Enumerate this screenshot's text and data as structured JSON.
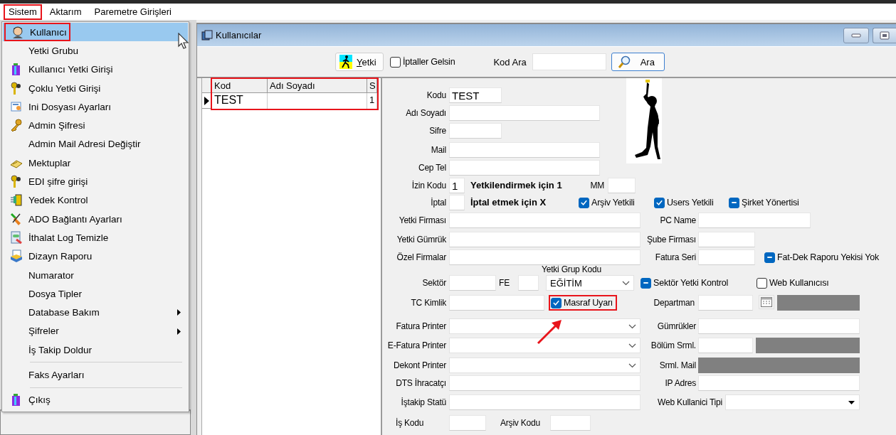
{
  "menubar": [
    {
      "label": "Sistem",
      "outlined": true
    },
    {
      "label": "Aktarım",
      "outlined": false
    },
    {
      "label": "Paremetre Girişleri",
      "outlined": false
    }
  ],
  "menu": {
    "items": [
      {
        "kind": "item",
        "label": "Kullanıcı",
        "selected": true,
        "submenu": false,
        "outlined": true
      },
      {
        "kind": "item",
        "label": "Yetki Grubu",
        "selected": false,
        "submenu": false,
        "outlined": false
      },
      {
        "kind": "item",
        "label": "Kullanıcı Yetki Girişi",
        "selected": false,
        "submenu": false,
        "outlined": false
      },
      {
        "kind": "item",
        "label": "Çoklu Yetki Girişi",
        "selected": false,
        "submenu": false,
        "outlined": false
      },
      {
        "kind": "item",
        "label": "Ini Dosyası  Ayarları",
        "selected": false,
        "submenu": false,
        "outlined": false
      },
      {
        "kind": "item",
        "label": "Admin Şifresi",
        "selected": false,
        "submenu": false,
        "outlined": false
      },
      {
        "kind": "item",
        "label": "Admin Mail Adresi Değiştir",
        "selected": false,
        "submenu": false,
        "outlined": false
      },
      {
        "kind": "item",
        "label": "Mektuplar",
        "selected": false,
        "submenu": false,
        "outlined": false
      },
      {
        "kind": "item",
        "label": "EDI şifre girişi",
        "selected": false,
        "submenu": false,
        "outlined": false
      },
      {
        "kind": "item",
        "label": "Yedek Kontrol",
        "selected": false,
        "submenu": false,
        "outlined": false
      },
      {
        "kind": "item",
        "label": "ADO Bağlantı Ayarları",
        "selected": false,
        "submenu": false,
        "outlined": false
      },
      {
        "kind": "item",
        "label": "İthalat Log Temizle",
        "selected": false,
        "submenu": false,
        "outlined": false
      },
      {
        "kind": "item",
        "label": "Dizayn Raporu",
        "selected": false,
        "submenu": false,
        "outlined": false
      },
      {
        "kind": "item",
        "label": "Numarator",
        "selected": false,
        "submenu": false,
        "outlined": false
      },
      {
        "kind": "item",
        "label": "Dosya Tipler",
        "selected": false,
        "submenu": false,
        "outlined": false
      },
      {
        "kind": "item",
        "label": "Database Bakım",
        "selected": false,
        "submenu": true,
        "outlined": false
      },
      {
        "kind": "item",
        "label": "Şifreler",
        "selected": false,
        "submenu": true,
        "outlined": false
      },
      {
        "kind": "item",
        "label": "İş Takip Doldur",
        "selected": false,
        "submenu": false,
        "outlined": false
      },
      {
        "kind": "separator"
      },
      {
        "kind": "item",
        "label": "Faks Ayarları",
        "selected": false,
        "submenu": false,
        "outlined": false
      },
      {
        "kind": "separator"
      },
      {
        "kind": "item",
        "label": "Çıkış",
        "selected": false,
        "submenu": false,
        "outlined": false
      }
    ]
  },
  "window": {
    "title": "Kullanıcılar"
  },
  "toolbar": {
    "yetki_button": "Yetki",
    "cancelled_checkbox": {
      "label": "İptaller Gelsin",
      "checked": false
    },
    "search_label": "Kod Ara",
    "search_button": "Ara"
  },
  "grid": {
    "outlined": true,
    "columns": [
      "Kod",
      "Adı Soyadı",
      "S"
    ],
    "rows": [
      {
        "selected": true,
        "cells": [
          "TEST",
          "",
          "1"
        ]
      }
    ]
  },
  "form": {
    "rows": [
      {
        "items": [
          {
            "kind": "label",
            "text": "Kodu"
          },
          {
            "kind": "input",
            "value": "TEST"
          }
        ]
      },
      {
        "items": [
          {
            "kind": "label",
            "text": "Adı Soyadı"
          },
          {
            "kind": "input"
          }
        ]
      },
      {
        "items": [
          {
            "kind": "label",
            "text": "Sifre"
          },
          {
            "kind": "input"
          }
        ]
      },
      {
        "items": [
          {
            "kind": "label",
            "text": "Mail"
          },
          {
            "kind": "input"
          }
        ]
      },
      {
        "items": [
          {
            "kind": "label",
            "text": "Cep Tel"
          },
          {
            "kind": "input"
          }
        ]
      },
      {
        "items": [
          {
            "kind": "label",
            "text": "İzin Kodu"
          },
          {
            "kind": "input",
            "value": "1"
          },
          {
            "kind": "note",
            "text": "Yetkilendirmek için 1"
          },
          {
            "kind": "label",
            "text": "MM"
          },
          {
            "kind": "input"
          }
        ]
      },
      {
        "items": [
          {
            "kind": "label",
            "text": "İptal"
          },
          {
            "kind": "input"
          },
          {
            "kind": "note",
            "text": "İptal etmek için X"
          },
          {
            "kind": "checkbox",
            "label": "Arşiv Yetkili",
            "checked": true,
            "indeterminate": false,
            "outlined": false
          },
          {
            "kind": "checkbox",
            "label": "Users Yetkili",
            "checked": true,
            "indeterminate": false,
            "outlined": false
          },
          {
            "kind": "checkbox",
            "label": "Şirket Yönertisi",
            "checked": false,
            "indeterminate": true,
            "outlined": false
          }
        ]
      },
      {
        "items": [
          {
            "kind": "label",
            "text": "Yetki Firması"
          },
          {
            "kind": "input"
          },
          {
            "kind": "label",
            "text": "PC Name"
          },
          {
            "kind": "input"
          }
        ]
      },
      {
        "items": [
          {
            "kind": "label",
            "text": "Yetki Gümrük"
          },
          {
            "kind": "input"
          },
          {
            "kind": "label",
            "text": "Şube Firması"
          },
          {
            "kind": "input"
          }
        ]
      },
      {
        "items": [
          {
            "kind": "label",
            "text": "Özel Firmalar"
          },
          {
            "kind": "input"
          },
          {
            "kind": "label",
            "text": "Fatura Seri"
          },
          {
            "kind": "input"
          },
          {
            "kind": "checkbox",
            "label": "Fat-Dek Raporu Yekisi Yok",
            "checked": false,
            "indeterminate": true,
            "outlined": false
          }
        ]
      },
      {
        "items": [
          {
            "kind": "label",
            "text": "Yetki Grup Kodu"
          }
        ]
      },
      {
        "items": [
          {
            "kind": "label",
            "text": "Sektör"
          },
          {
            "kind": "input"
          },
          {
            "kind": "label",
            "text": "FE"
          },
          {
            "kind": "input"
          },
          {
            "kind": "combo",
            "value": "EĞİTİM"
          },
          {
            "kind": "checkbox",
            "label": "Sektör Yetki Kontrol",
            "checked": false,
            "indeterminate": true,
            "outlined": false
          },
          {
            "kind": "checkbox",
            "label": "Web Kullanıcısı",
            "checked": false,
            "indeterminate": false,
            "outlined": false
          }
        ]
      },
      {
        "items": [
          {
            "kind": "label",
            "text": "TC Kimlik"
          },
          {
            "kind": "input"
          },
          {
            "kind": "checkbox",
            "label": "Masraf Uyarı",
            "checked": true,
            "indeterminate": false,
            "outlined": true
          },
          {
            "kind": "label",
            "text": "Departman"
          },
          {
            "kind": "input"
          },
          {
            "kind": "calendar"
          },
          {
            "kind": "locked"
          }
        ]
      },
      {
        "items": [
          {
            "kind": "label",
            "text": "Fatura Printer"
          },
          {
            "kind": "combo"
          },
          {
            "kind": "label",
            "text": "Gümrükler"
          },
          {
            "kind": "input"
          }
        ]
      },
      {
        "items": [
          {
            "kind": "label",
            "text": "E-Fatura Printer"
          },
          {
            "kind": "combo"
          },
          {
            "kind": "label",
            "text": "Bölüm Srml."
          },
          {
            "kind": "input"
          },
          {
            "kind": "locked"
          }
        ]
      },
      {
        "items": [
          {
            "kind": "label",
            "text": "Dekont Printer"
          },
          {
            "kind": "combo"
          },
          {
            "kind": "label",
            "text": "Srml. Mail"
          },
          {
            "kind": "locked"
          }
        ]
      },
      {
        "items": [
          {
            "kind": "label",
            "text": "DTS İhracatçı"
          },
          {
            "kind": "input"
          },
          {
            "kind": "label",
            "text": "IP Adres"
          },
          {
            "kind": "input"
          }
        ]
      },
      {
        "items": [
          {
            "kind": "label",
            "text": "İştakip Statü"
          },
          {
            "kind": "input"
          },
          {
            "kind": "label",
            "text": "Web Kullanici Tipi"
          },
          {
            "kind": "dropdown"
          }
        ]
      },
      {
        "items": [
          {
            "kind": "label",
            "text": "İş Kodu"
          },
          {
            "kind": "input"
          },
          {
            "kind": "label",
            "text": "Arşiv Kodu"
          },
          {
            "kind": "input"
          }
        ]
      }
    ]
  }
}
